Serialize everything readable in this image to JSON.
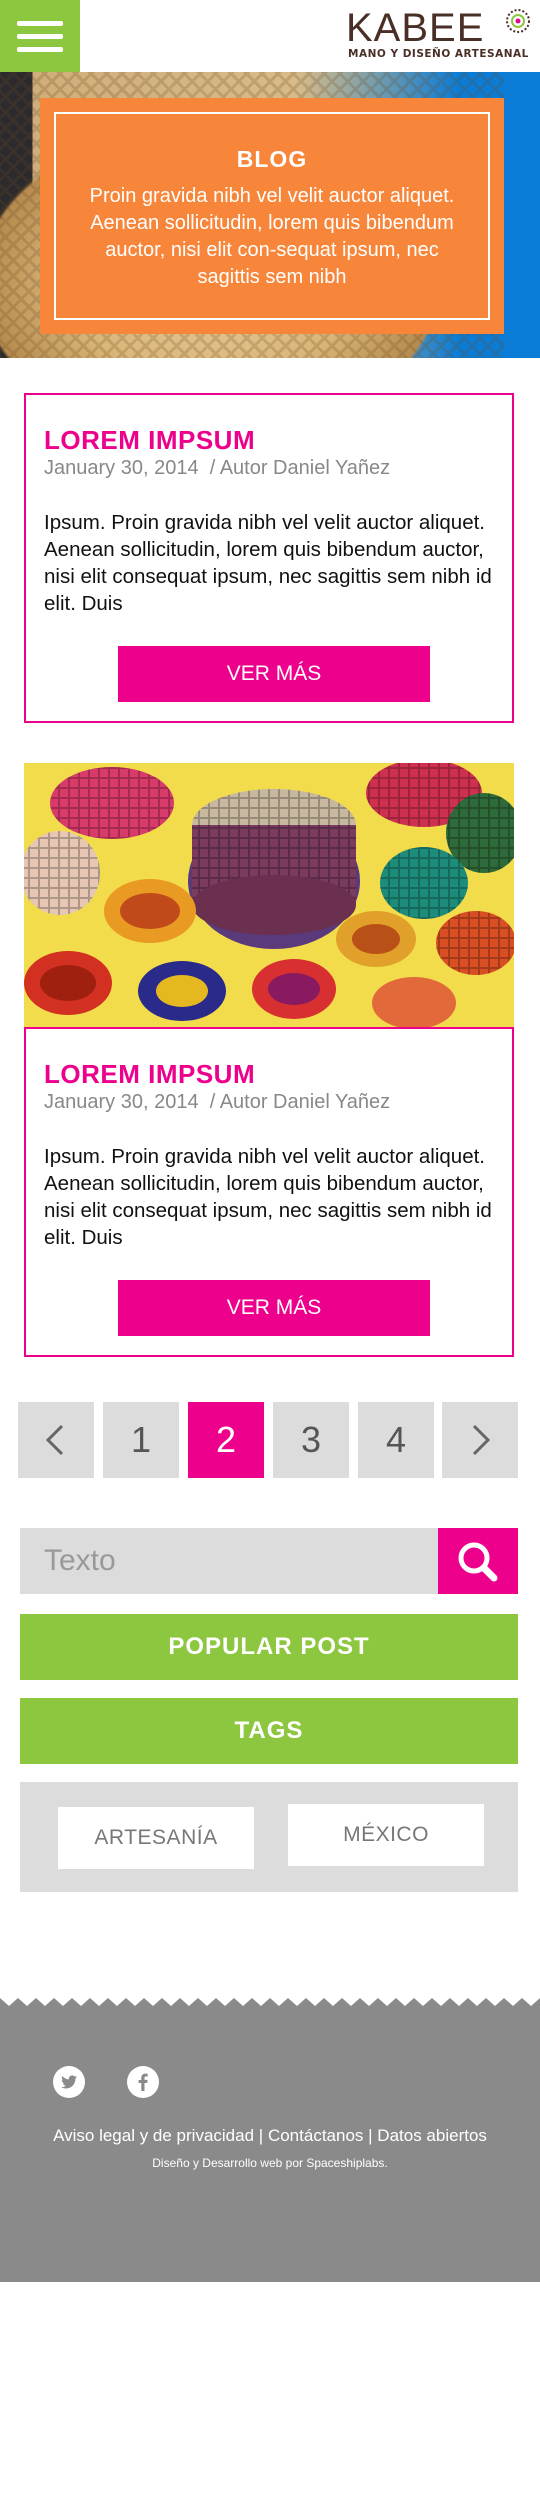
{
  "header": {
    "logo_word": "KABEE",
    "logo_subtitle": "MANO Y DISEÑO ARTESANAL"
  },
  "hero": {
    "title": "BLOG",
    "text": "Proin gravida nibh vel velit auctor aliquet. Aenean sollicitudin, lorem quis bibendum auctor, nisi elit con-sequat ipsum, nec sagittis sem nibh"
  },
  "posts": [
    {
      "title": "LOREM IMPSUM",
      "date": "January 30, 2014",
      "author": "/ Autor Daniel Yañez",
      "excerpt": "Ipsum. Proin gravida nibh vel velit auctor aliquet. Aenean sollicitudin, lorem quis bibendum auctor, nisi elit consequat ipsum, nec sagittis sem nibh id elit. Duis",
      "button": "VER MÁS"
    },
    {
      "title": "LOREM IMPSUM",
      "date": "January 30, 2014",
      "author": "/ Autor Daniel Yañez",
      "excerpt": "Ipsum. Proin gravida nibh vel velit auctor aliquet. Aenean sollicitudin, lorem quis bibendum auctor, nisi elit consequat ipsum, nec sagittis sem nibh id elit. Duis",
      "button": "VER MÁS"
    }
  ],
  "pagination": {
    "prev": "‹",
    "pages": [
      "1",
      "2",
      "3",
      "4"
    ],
    "current": "2",
    "next": "›"
  },
  "search": {
    "placeholder": "Texto"
  },
  "sidebar": {
    "popular_post": "POPULAR POST",
    "tags_label": "TAGS",
    "tags": [
      "ARTESANÍA",
      "MÉXICO"
    ]
  },
  "footer": {
    "links": [
      "Aviso legal y de privacidad",
      "Contáctanos",
      "Datos abiertos"
    ],
    "separator": "|",
    "credit": "Diseño y Desarrollo web por Spaceshiplabs."
  },
  "colors": {
    "green": "#8dc63f",
    "magenta": "#ec008c",
    "orange": "#f7863a",
    "footer_gray": "#8a8a8a"
  }
}
